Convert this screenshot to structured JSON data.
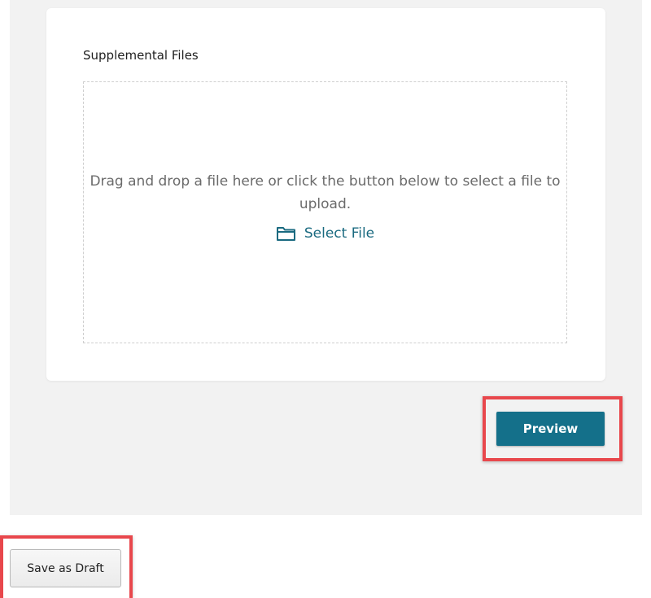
{
  "upload": {
    "section_title": "Supplemental Files",
    "instructions": "Drag and drop a file here or click the button below to select a file to upload.",
    "select_file_label": "Select File",
    "icon": "folder-icon"
  },
  "actions": {
    "preview_label": "Preview",
    "save_draft_label": "Save as Draft"
  },
  "colors": {
    "accent": "#14708a",
    "link": "#1a6a80",
    "highlight": "#e8474c",
    "panel_bg": "#f2f2f2"
  }
}
